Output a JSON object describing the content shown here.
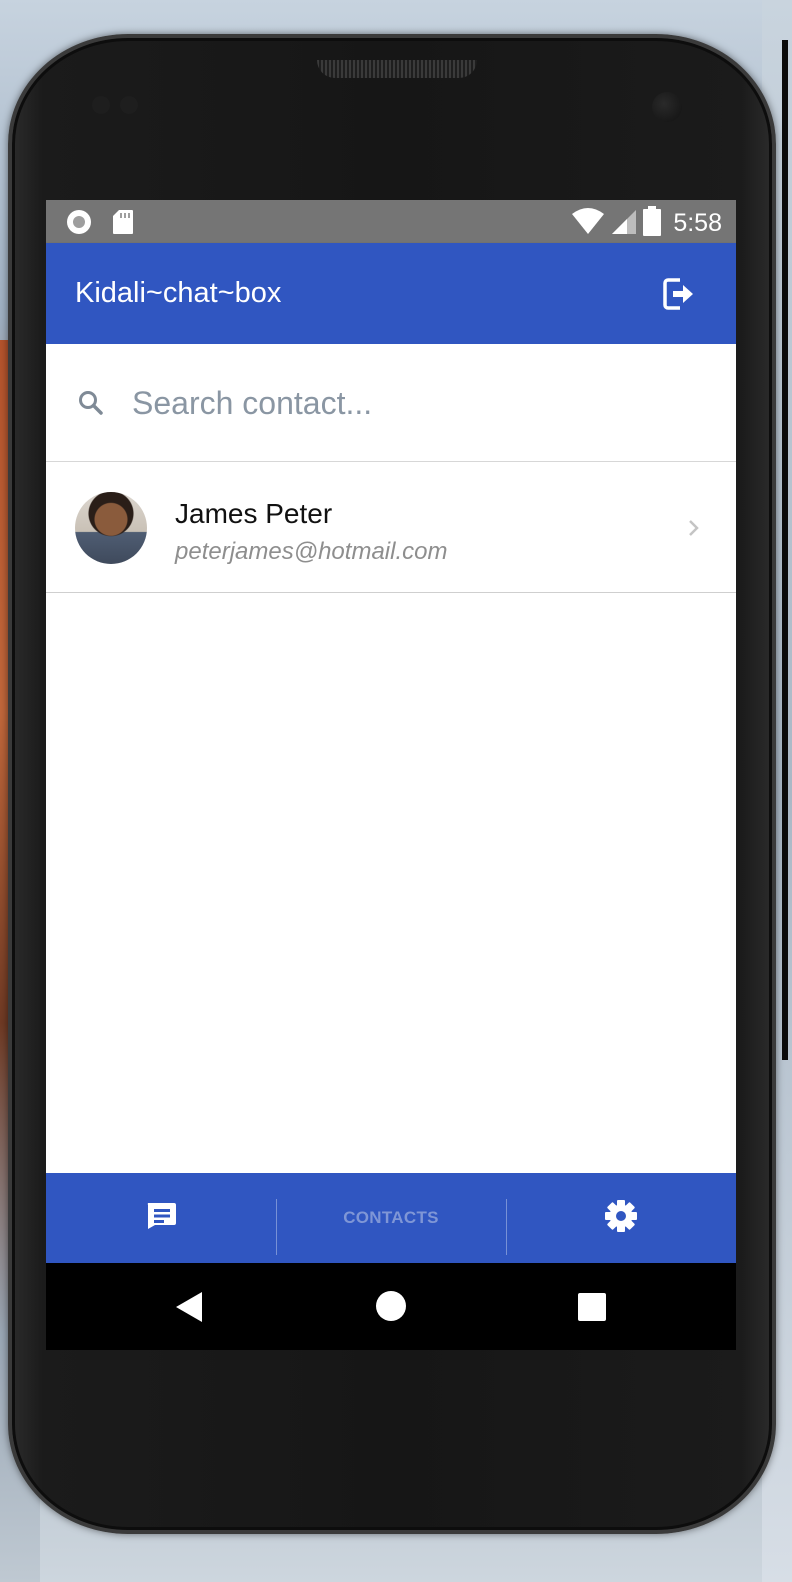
{
  "status_bar": {
    "time": "5:58"
  },
  "app_bar": {
    "title": "Kidali~chat~box"
  },
  "search": {
    "placeholder": "Search contact...",
    "value": ""
  },
  "contacts": [
    {
      "name": "James Peter",
      "email": "peterjames@hotmail.com"
    }
  ],
  "tabs": [
    {
      "label": "",
      "icon": "chat-icon"
    },
    {
      "label": "CONTACTS"
    },
    {
      "label": "",
      "icon": "gear-icon"
    }
  ],
  "colors": {
    "primary": "#3056c1",
    "status_bar": "#757575",
    "inactive_tab_text": "#7f96d6"
  }
}
